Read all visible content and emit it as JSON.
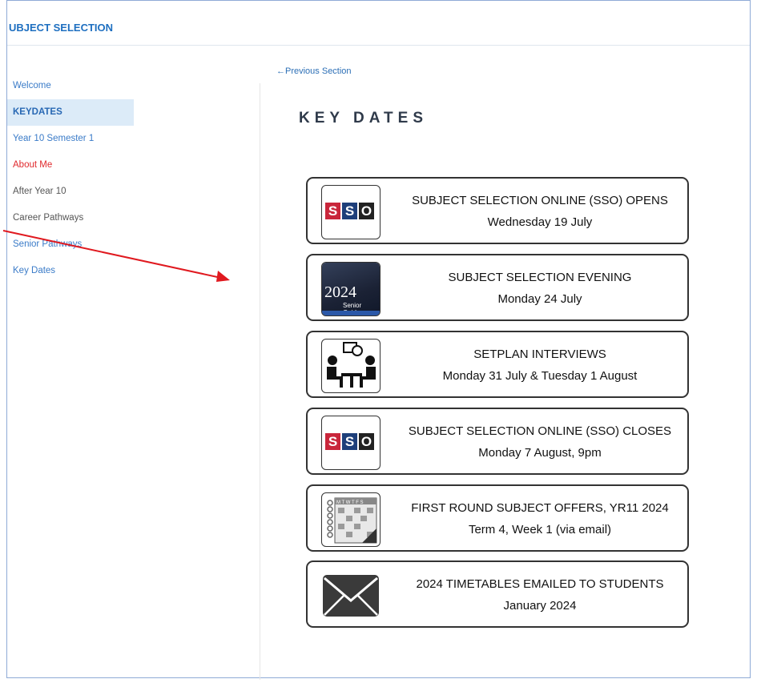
{
  "header": {
    "title": "UBJECT SELECTION"
  },
  "sidebar": {
    "items": [
      {
        "label": "Welcome"
      },
      {
        "label": "KEYDATES"
      },
      {
        "label": "Year 10 Semester 1"
      },
      {
        "label": "About Me"
      },
      {
        "label": "After Year 10"
      },
      {
        "label": "Career Pathways"
      },
      {
        "label": "Senior Pathways"
      },
      {
        "label": "Key Dates"
      }
    ]
  },
  "nav": {
    "previous": "←Previous Section"
  },
  "main": {
    "title": "KEY DATES",
    "cards": [
      {
        "title": "SUBJECT SELECTION ONLINE (SSO) OPENS",
        "date": "Wednesday 19 July",
        "icon": "sso-logo-icon"
      },
      {
        "title": "SUBJECT SELECTION EVENING",
        "date": "Monday 24 July",
        "icon": "senior-guide-icon"
      },
      {
        "title": "SETPLAN INTERVIEWS",
        "date": "Monday 31 July & Tuesday 1 August",
        "icon": "interview-icon"
      },
      {
        "title": "SUBJECT SELECTION ONLINE (SSO) CLOSES",
        "date": "Monday 7 August, 9pm",
        "icon": "sso-logo-icon"
      },
      {
        "title": "FIRST ROUND SUBJECT OFFERS, YR11 2024",
        "date": "Term 4, Week 1  (via email)",
        "icon": "calendar-icon"
      },
      {
        "title": "2024 TIMETABLES EMAILED TO STUDENTS",
        "date": "January 2024",
        "icon": "envelope-icon"
      }
    ]
  },
  "icons": {
    "sso": {
      "s1": "S",
      "s2": "S",
      "o": "O"
    },
    "guide": {
      "year": "2024",
      "subtitle": "Senior Guide"
    },
    "calendar": {
      "header": "M T W T F S"
    }
  },
  "colors": {
    "accent": "#1e6fc0",
    "active_bg": "#dcebf8",
    "alert": "#e0292d",
    "annotation_arrow": "#e0191f"
  }
}
